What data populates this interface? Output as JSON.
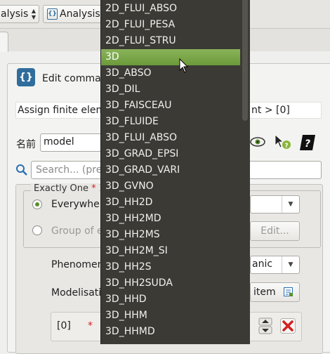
{
  "toolbar": {
    "combo1_value": "alysis",
    "combo2_value": "Analysis"
  },
  "panel": {
    "title": "Edit comman",
    "info": "Assign finite elem",
    "info_right": "nt > [0]",
    "name_label": "名前",
    "name_value": "model",
    "search_placeholder": "Search... (pres"
  },
  "form": {
    "exactly_one": "Exactly One",
    "required_mark": "*",
    "option1": "Everywhere",
    "option2": "Group of e",
    "edit_button": "Edit...",
    "phenomenon_label": "Phenomen",
    "phenomenon_value": "anic",
    "modelisation_label": "Modelisati",
    "add_item_label": "item",
    "row_index": "[0]",
    "row_required": "*"
  },
  "dropdown": {
    "items": [
      "2D_FLUI_ABSO",
      "2D_FLUI_PESA",
      "2D_FLUI_STRU",
      "3D",
      "3D_ABSO",
      "3D_DIL",
      "3D_FAISCEAU",
      "3D_FLUIDE",
      "3D_FLUI_ABSO",
      "3D_GRAD_EPSI",
      "3D_GRAD_VARI",
      "3D_GVNO",
      "3D_HH2D",
      "3D_HH2MD",
      "3D_HH2MS",
      "3D_HH2M_SI",
      "3D_HH2S",
      "3D_HH2SUDA",
      "3D_HHD",
      "3D_HHM",
      "3D_HHMD"
    ],
    "selected_index": 3
  },
  "colors": {
    "popup_bg": "#3b3a35",
    "selection": "#7aa84a",
    "delete_red": "#d42020"
  }
}
